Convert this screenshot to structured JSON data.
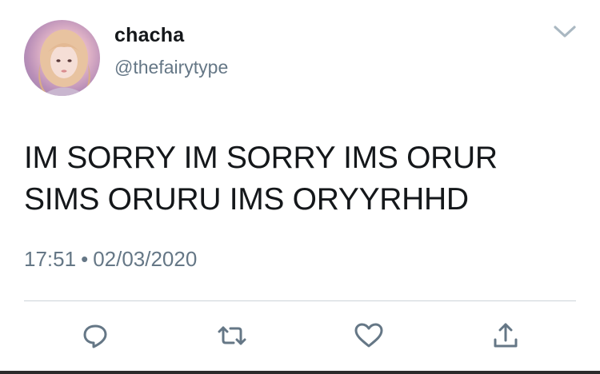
{
  "tweet": {
    "display_name": "chacha",
    "handle": "@thefairytype",
    "text": "IM SORRY IM SORRY IMS ORUR\nSIMS ORURU IMS ORYYRHHD",
    "time": "17:51",
    "separator": "•",
    "date": "02/03/2020"
  },
  "icons": {
    "avatar": "profile-photo",
    "menu": "chevron-down-icon",
    "reply": "reply-icon",
    "retweet": "retweet-icon",
    "like": "heart-icon",
    "share": "share-icon"
  },
  "colors": {
    "text": "#14171a",
    "secondary": "#657786",
    "icon": "#657786",
    "chevron": "#aab8c2",
    "divider": "#cdd3d8"
  }
}
